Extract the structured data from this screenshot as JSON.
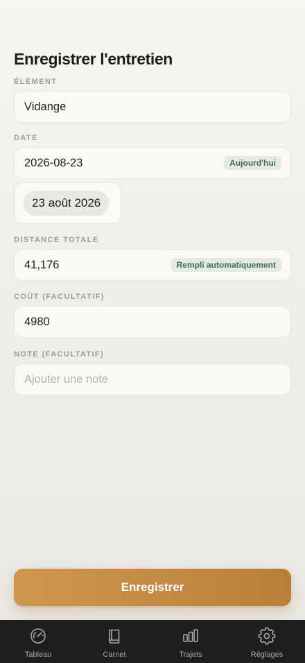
{
  "page": {
    "title": "Enregistrer l'entretien"
  },
  "element": {
    "label": "ÉLÉMENT",
    "value": "Vidange"
  },
  "date": {
    "label": "DATE",
    "value": "2026-08-23",
    "badge": "Aujourd'hui",
    "picker_value": "23 août 2026"
  },
  "distance": {
    "label": "DISTANCE TOTALE",
    "value": "41,176",
    "badge": "Rempli automatiquement"
  },
  "cost": {
    "label": "COÛT (FACULTATIF)",
    "value": "4980"
  },
  "note": {
    "label": "NOTE (FACULTATIF)",
    "placeholder": "Ajouter une note"
  },
  "save_button": {
    "label": "Enregistrer"
  },
  "tab_bar": {
    "items": [
      {
        "label": "Tableau",
        "icon": "gauge-icon"
      },
      {
        "label": "Carnet",
        "icon": "book-icon"
      },
      {
        "label": "Trajets",
        "icon": "bars-icon"
      },
      {
        "label": "Réglages",
        "icon": "gear-icon"
      }
    ]
  },
  "colors": {
    "accent": "#c48a45",
    "badge_background": "#e3ebe4",
    "badge_text": "#456b4e",
    "tab_bar_background": "#1e1e1e"
  }
}
